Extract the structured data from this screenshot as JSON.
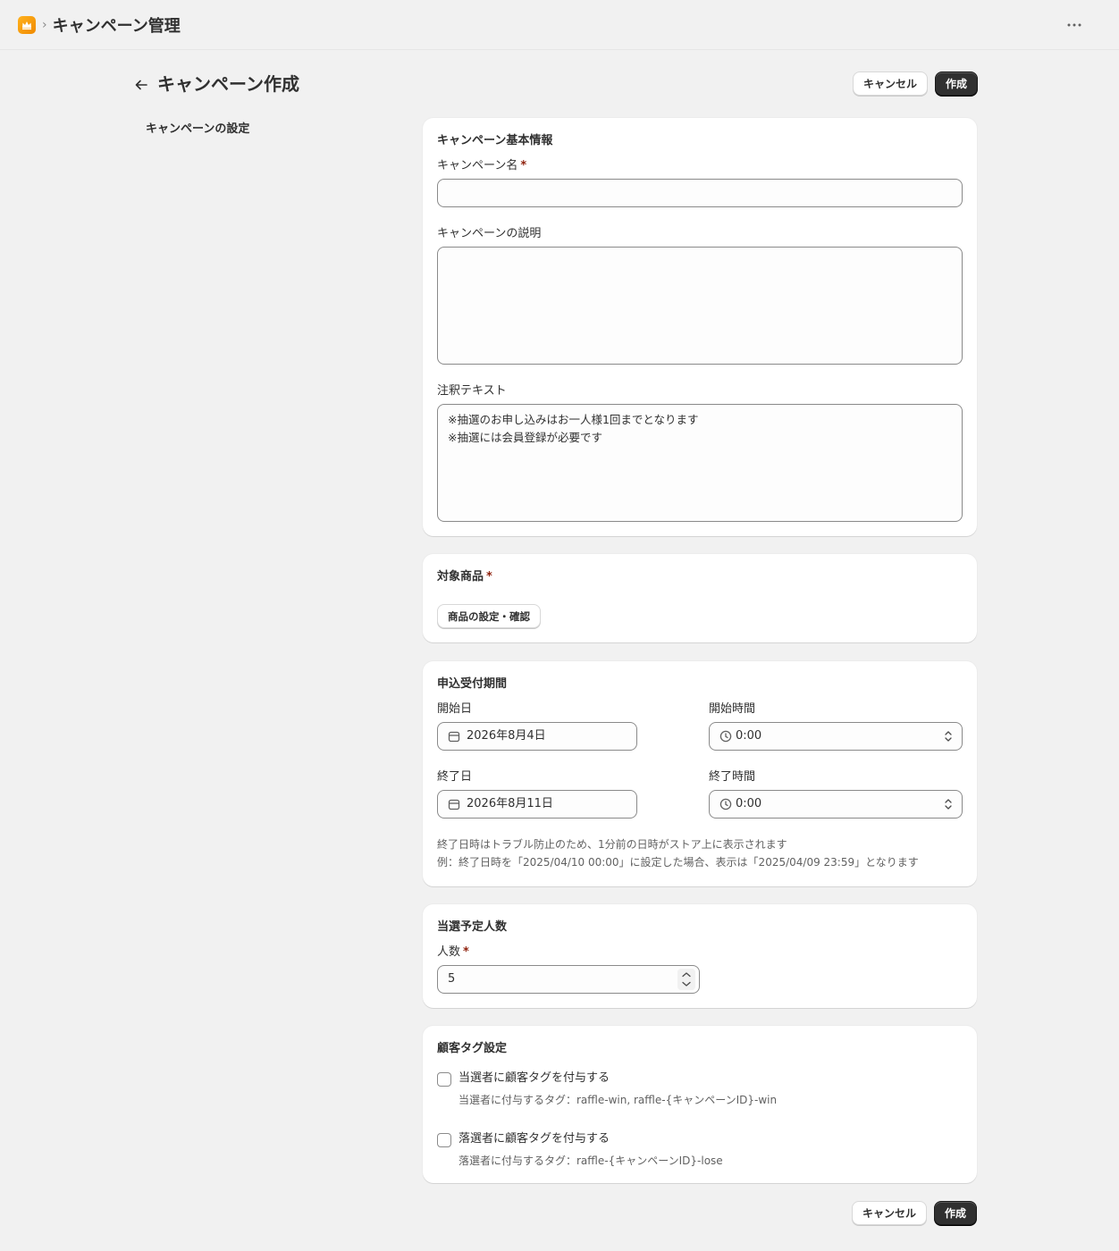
{
  "topbar": {
    "breadcrumb_separator": "›",
    "app_title": "キャンペーン管理"
  },
  "header": {
    "title": "キャンペーン作成",
    "cancel_label": "キャンセル",
    "create_label": "作成"
  },
  "sidebar": {
    "section_label": "キャンペーンの設定"
  },
  "basic_info": {
    "title": "キャンペーン基本情報",
    "name_label": "キャンペーン名",
    "name_value": "",
    "required_mark": "*",
    "description_label": "キャンペーンの説明",
    "description_value": "",
    "notes_label": "注釈テキスト",
    "notes_value": "※抽選のお申し込みはお一人様1回までとなります\n※抽選には会員登録が必要です"
  },
  "products": {
    "title": "対象商品",
    "required_mark": "*",
    "button_label": "商品の設定・確認"
  },
  "period": {
    "title": "申込受付期間",
    "start_date_label": "開始日",
    "start_date_value": "2026年8月4日",
    "start_time_label": "開始時間",
    "start_time_value": "0:00",
    "end_date_label": "終了日",
    "end_date_value": "2026年8月11日",
    "end_time_label": "終了時間",
    "end_time_value": "0:00",
    "help_line1": "終了日時はトラブル防止のため、1分前の日時がストア上に表示されます",
    "help_line2": "例：終了日時を「2025/04/10 00:00」に設定した場合、表示は「2025/04/09 23:59」となります"
  },
  "winners": {
    "title": "当選予定人数",
    "count_label": "人数",
    "required_mark": "*",
    "count_value": "5"
  },
  "tags": {
    "title": "顧客タグ設定",
    "winner_checkbox_label": "当選者に顧客タグを付与する",
    "winner_checked": false,
    "winner_help": "当選者に付与するタグ：raffle-win, raffle-{キャンペーンID}-win",
    "loser_checkbox_label": "落選者に顧客タグを付与する",
    "loser_checked": false,
    "loser_help": "落選者に付与するタグ：raffle-{キャンペーンID}-lose"
  },
  "footer": {
    "cancel_label": "キャンセル",
    "create_label": "作成"
  },
  "colors": {
    "page_bg": "#f1f1f1",
    "primary_button": "#303030",
    "required_mark": "#8e1f0b",
    "app_icon": "#f5a000"
  },
  "icons": {
    "app": "crown-icon",
    "more": "more-horizontal-icon",
    "back": "arrow-left-icon",
    "date": "calendar-icon",
    "time": "clock-icon",
    "select": "chevron-up-down-icon"
  }
}
